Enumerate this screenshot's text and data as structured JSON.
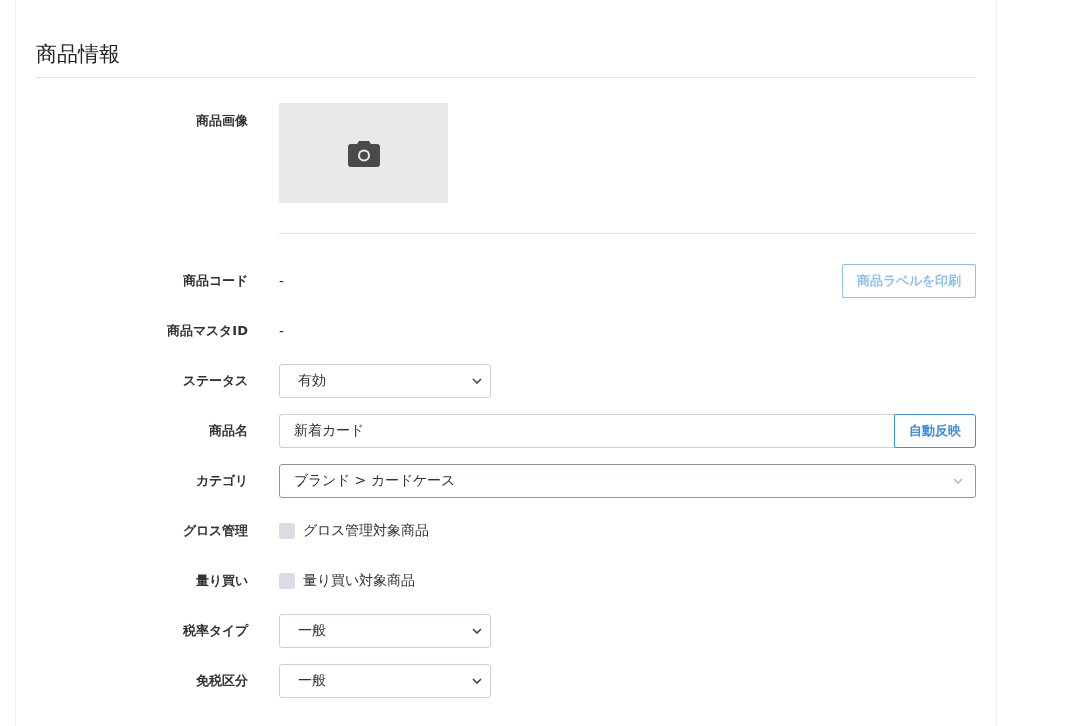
{
  "section": {
    "title": "商品情報"
  },
  "image_field": {
    "label": "商品画像"
  },
  "rows": [
    {
      "kind": "text",
      "label": "商品コード",
      "value": "-",
      "button": {
        "label": "商品ラベルを印刷",
        "disabled": true
      }
    },
    {
      "kind": "text",
      "label": "商品マスタID",
      "value": "-"
    },
    {
      "kind": "select",
      "label": "ステータス",
      "value": "有効"
    },
    {
      "kind": "input",
      "label": "商品名",
      "value": "新着カード",
      "button": {
        "label": "自動反映",
        "disabled": false
      }
    },
    {
      "kind": "combo",
      "label": "カテゴリ",
      "value": "ブランド > カードケース"
    },
    {
      "kind": "checkbox",
      "label": "グロス管理",
      "option": "グロス管理対象商品",
      "checked": false
    },
    {
      "kind": "checkbox",
      "label": "量り買い",
      "option": "量り買い対象商品",
      "checked": false
    },
    {
      "kind": "select",
      "label": "税率タイプ",
      "value": "一般"
    },
    {
      "kind": "select",
      "label": "免税区分",
      "value": "一般"
    }
  ]
}
